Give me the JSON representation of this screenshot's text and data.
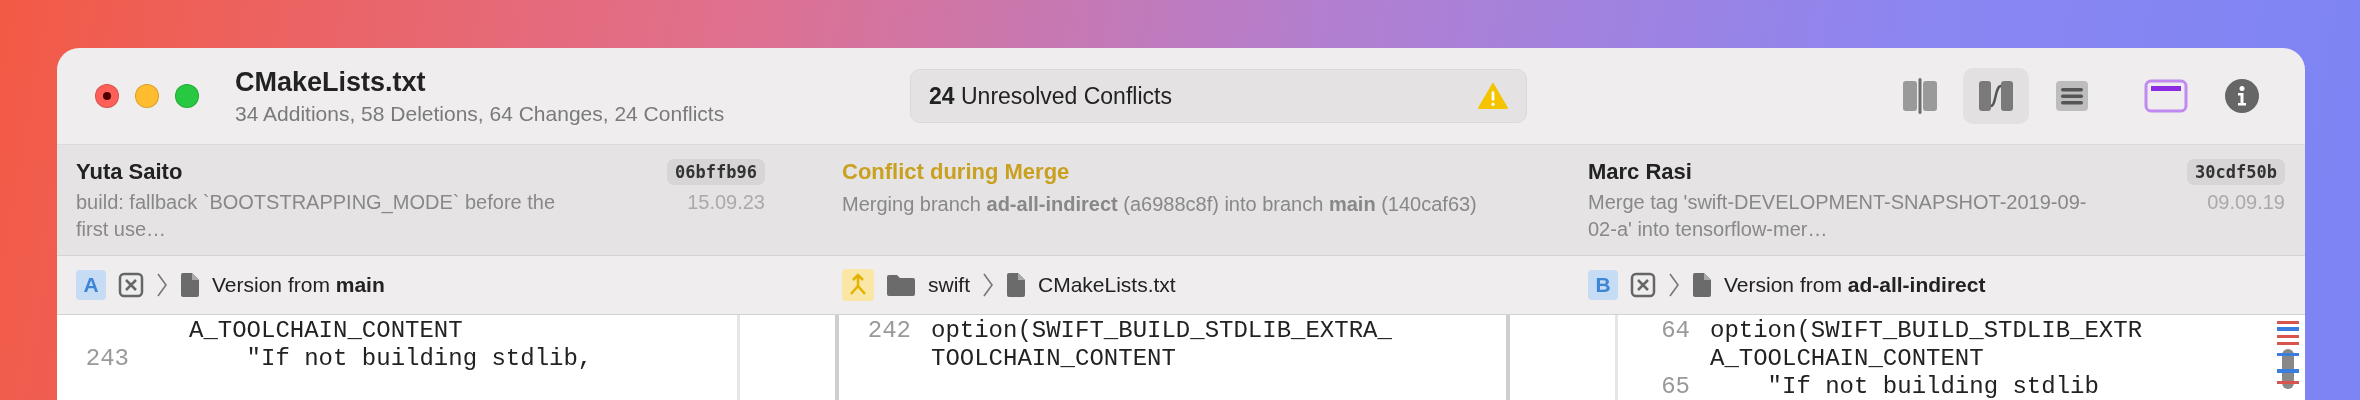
{
  "window": {
    "title": "CMakeLists.txt",
    "subtitle": "34 Additions, 58 Deletions, 64 Changes, 24 Conflicts",
    "edited": true
  },
  "status": {
    "text": "**24** Unresolved Conflicts",
    "warning": true
  },
  "view_buttons": [
    {
      "kind": "columns",
      "selected": false
    },
    {
      "kind": "connected",
      "selected": true
    },
    {
      "kind": "list",
      "selected": false
    }
  ],
  "panel_toggle": {
    "on": true
  },
  "info": [
    {
      "kind": "commit",
      "author": "Yuta Saito",
      "hash": "06bffb96",
      "message": "build: fallback `BOOTSTRAPPING_MODE` before the first use…",
      "date": "15.09.23"
    },
    {
      "kind": "merge",
      "title": "Conflict during Merge",
      "message": "Merging branch **ad-all-indirect** (a6988c8f) into branch **main** (140caf63)"
    },
    {
      "kind": "commit",
      "author": "Marc Rasi",
      "hash": "30cdf50b",
      "message": "Merge tag 'swift-DEVELOPMENT-SNAPSHOT-2019-09-02-a' into tensorflow-mer…",
      "date": "09.09.19"
    }
  ],
  "paths": [
    {
      "kind": "version",
      "badge": "A",
      "label": "Version from **main**"
    },
    {
      "kind": "merged",
      "folder": "swift",
      "file": "CMakeLists.txt"
    },
    {
      "kind": "version",
      "badge": "B",
      "label": "Version from **ad-all-indirect**"
    }
  ],
  "code": [
    {
      "lines": [
        {
          "text": "A_TOOLCHAIN_CONTENT"
        },
        {
          "number": "243",
          "text": "    \"If not building stdlib,"
        }
      ]
    },
    {
      "lines": [
        {
          "number": "242",
          "text": "option(SWIFT_BUILD_STDLIB_EXTRA_"
        },
        {
          "text": "TOOLCHAIN_CONTENT"
        }
      ]
    },
    {
      "lines": [
        {
          "number": "64",
          "text": "option(SWIFT_BUILD_STDLIB_EXTR"
        },
        {
          "text": "A_TOOLCHAIN_CONTENT"
        },
        {
          "number": "65",
          "text": "    \"If not building stdlib"
        }
      ]
    }
  ]
}
